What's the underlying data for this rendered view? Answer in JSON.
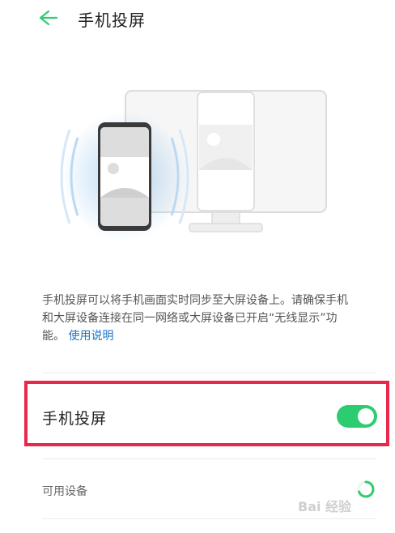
{
  "header": {
    "title": "手机投屏"
  },
  "description": {
    "text": "手机投屏可以将手机画面实时同步至大屏设备上。请确保手机和大屏设备连接在同一网络或大屏设备已开启“无线显示”功能。",
    "link": "使用说明"
  },
  "setting": {
    "label": "手机投屏",
    "enabled": true
  },
  "devices": {
    "label": "可用设备"
  },
  "watermark": {
    "text": "Bai 经验"
  },
  "colors": {
    "accent": "#2ecc71",
    "link": "#1a73c8",
    "highlight": "#e8294b"
  }
}
